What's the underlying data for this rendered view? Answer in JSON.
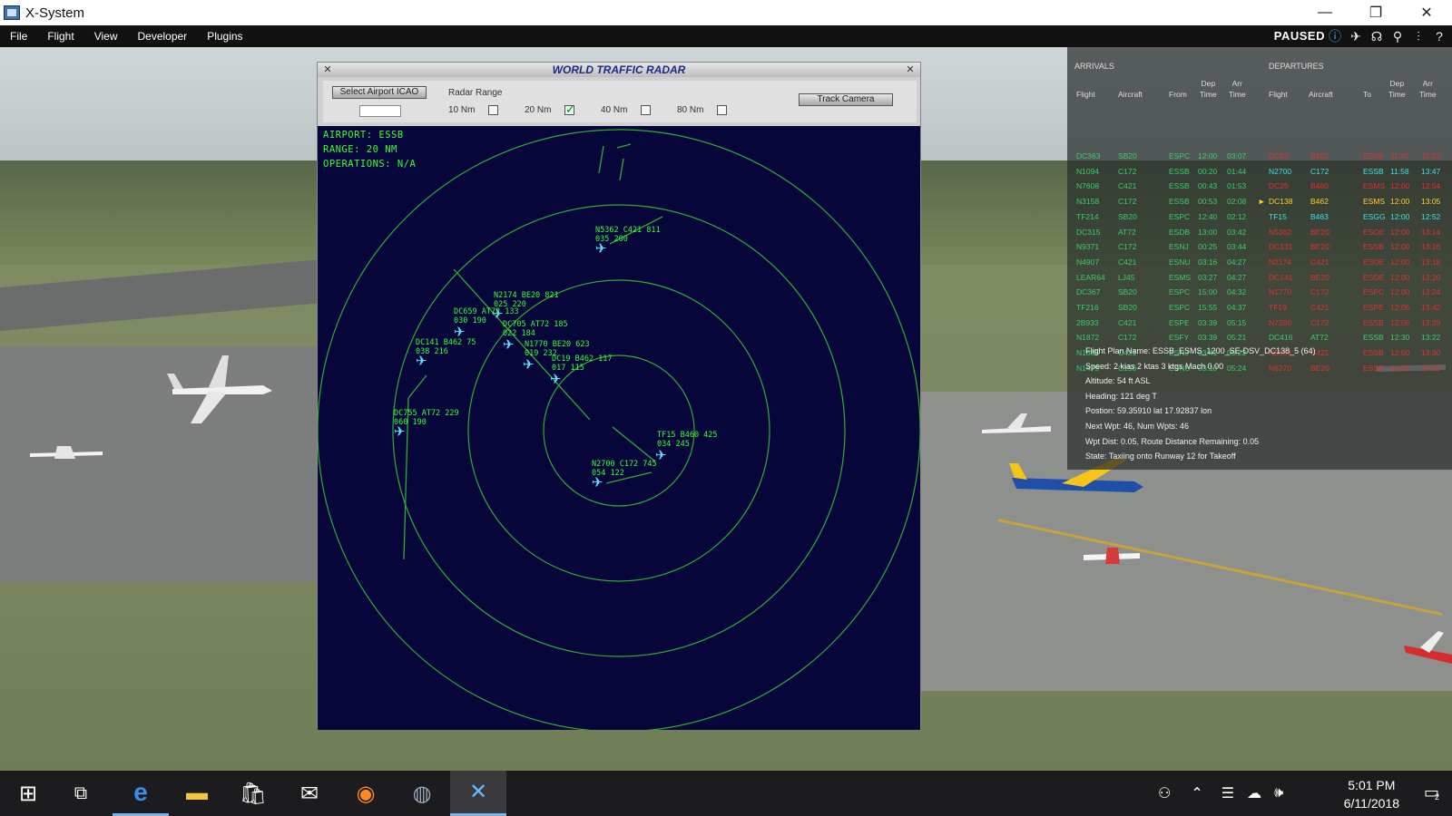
{
  "window": {
    "title": "X-System",
    "minimize": "—",
    "restore": "❐",
    "close": "✕"
  },
  "menubar": {
    "items": [
      "File",
      "Flight",
      "View",
      "Developer",
      "Plugins"
    ],
    "status": "PAUSED"
  },
  "radar": {
    "title": "WORLD TRAFFIC RADAR",
    "select_airport_label": "Select Airport ICAO",
    "icao_value": "",
    "radar_range_label": "Radar Range",
    "ranges": [
      {
        "label": "10 Nm",
        "checked": false
      },
      {
        "label": "20 Nm",
        "checked": true
      },
      {
        "label": "40 Nm",
        "checked": false
      },
      {
        "label": "80 Nm",
        "checked": false
      }
    ],
    "track_camera_label": "Track Camera",
    "airport_line": "AIRPORT:  ESSB",
    "range_line": "RANGE:  20 NM",
    "operations_line": "OPERATIONS:  N/A",
    "targets": [
      {
        "l1": "N5362 C421 811",
        "l2": "035  200"
      },
      {
        "l1": "N2174 BE20 821",
        "l2": "025  220"
      },
      {
        "l1": "DC659 AT72 133",
        "l2": "030  190"
      },
      {
        "l1": "DC705 AT72 185",
        "l2": "022  184"
      },
      {
        "l1": "DC141 B462 75",
        "l2": "038  216"
      },
      {
        "l1": "N1770 BE20 623",
        "l2": "019  232"
      },
      {
        "l1": "DC19 B462 117",
        "l2": "017  115"
      },
      {
        "l1": "DC755 AT72 229",
        "l2": "060  190"
      },
      {
        "l1": "TF15 B460 425",
        "l2": "034  245"
      },
      {
        "l1": "N2700 C172 745",
        "l2": "054  122"
      }
    ]
  },
  "board": {
    "arrivals_label": "ARRIVALS",
    "departures_label": "DEPARTURES",
    "headers": {
      "a_flight": "Flight",
      "a_aircraft": "Aircraft",
      "a_from": "From",
      "a_dep": "Dep\nTime",
      "a_arr": "Arr\nTime",
      "d_flight": "Flight",
      "d_aircraft": "Aircraft",
      "d_to": "To",
      "d_dep": "Dep\nTime",
      "d_arr": "Arr\nTime"
    },
    "arrivals": [
      {
        "flight": "DC363",
        "aircraft": "SB20",
        "from": "ESPC",
        "dep": "12:00",
        "arr": "03:07"
      },
      {
        "flight": "N1094",
        "aircraft": "C172",
        "from": "ESSB",
        "dep": "00:20",
        "arr": "01:44"
      },
      {
        "flight": "N7608",
        "aircraft": "C421",
        "from": "ESSB",
        "dep": "00:43",
        "arr": "01:53"
      },
      {
        "flight": "N3158",
        "aircraft": "C172",
        "from": "ESSB",
        "dep": "00:53",
        "arr": "02:08"
      },
      {
        "flight": "TF214",
        "aircraft": "SB20",
        "from": "ESPC",
        "dep": "12:40",
        "arr": "02:12"
      },
      {
        "flight": "DC315",
        "aircraft": "AT72",
        "from": "ESDB",
        "dep": "13:00",
        "arr": "03:42"
      },
      {
        "flight": "N9371",
        "aircraft": "C172",
        "from": "ESNJ",
        "dep": "00:25",
        "arr": "03:44"
      },
      {
        "flight": "N4907",
        "aircraft": "C421",
        "from": "ESNU",
        "dep": "03:16",
        "arr": "04:27"
      },
      {
        "flight": "LEAR64",
        "aircraft": "LJ45",
        "from": "ESMS",
        "dep": "03:27",
        "arr": "04:27"
      },
      {
        "flight": "DC367",
        "aircraft": "SB20",
        "from": "ESPC",
        "dep": "15:00",
        "arr": "04:32"
      },
      {
        "flight": "TF216",
        "aircraft": "SB20",
        "from": "ESPC",
        "dep": "15:55",
        "arr": "04:37"
      },
      {
        "flight": "2B933",
        "aircraft": "C421",
        "from": "ESPE",
        "dep": "03:39",
        "arr": "05:15"
      },
      {
        "flight": "N1872",
        "aircraft": "C172",
        "from": "ESFY",
        "dep": "03:39",
        "arr": "05:21"
      },
      {
        "flight": "N1885",
        "aircraft": "C421",
        "from": "ESNJ",
        "dep": "03:41",
        "arr": "05:22"
      },
      {
        "flight": "N1479",
        "aircraft": "C150",
        "from": "ESNU",
        "dep": "03:10",
        "arr": "05:24"
      }
    ],
    "departures": [
      {
        "flight": "DC63",
        "aircraft": "B462",
        "to": "ESSB",
        "dep": "11:47",
        "arr": "12:53",
        "status": "red"
      },
      {
        "flight": "N2700",
        "aircraft": "C172",
        "to": "ESSB",
        "dep": "11:58",
        "arr": "13:47",
        "status": "cyan"
      },
      {
        "flight": "DC25",
        "aircraft": "B460",
        "to": "ESMS",
        "dep": "12:00",
        "arr": "12:54",
        "status": "red"
      },
      {
        "flight": "DC138",
        "aircraft": "B462",
        "to": "ESMS",
        "dep": "12:00",
        "arr": "13:05",
        "status": "yellow",
        "marker": "►"
      },
      {
        "flight": "TF15",
        "aircraft": "B463",
        "to": "ESGG",
        "dep": "12:00",
        "arr": "12:52",
        "status": "cyan"
      },
      {
        "flight": "N5362",
        "aircraft": "BE20",
        "to": "ESOE",
        "dep": "12:00",
        "arr": "13:14",
        "status": "red"
      },
      {
        "flight": "DC131",
        "aircraft": "BE20",
        "to": "ESSB",
        "dep": "12:00",
        "arr": "13:16",
        "status": "red"
      },
      {
        "flight": "N2174",
        "aircraft": "C421",
        "to": "ESOE",
        "dep": "12:00",
        "arr": "13:18",
        "status": "red"
      },
      {
        "flight": "DC141",
        "aircraft": "BE20",
        "to": "ESOE",
        "dep": "12:00",
        "arr": "13:20",
        "status": "red"
      },
      {
        "flight": "N1770",
        "aircraft": "C172",
        "to": "ESPC",
        "dep": "12:00",
        "arr": "13:24",
        "status": "red"
      },
      {
        "flight": "TF19",
        "aircraft": "C421",
        "to": "ESPE",
        "dep": "12:06",
        "arr": "13:42",
        "status": "red"
      },
      {
        "flight": "N7260",
        "aircraft": "C172",
        "to": "ESSB",
        "dep": "12:06",
        "arr": "13:39",
        "status": "red"
      },
      {
        "flight": "DC416",
        "aircraft": "AT72",
        "to": "ESSB",
        "dep": "12:30",
        "arr": "13:22",
        "status": "green"
      },
      {
        "flight": "N2614",
        "aircraft": "C421",
        "to": "ESSB",
        "dep": "12:00",
        "arr": "13:30",
        "status": "red"
      },
      {
        "flight": "N6270",
        "aircraft": "BE20",
        "to": "ESSB",
        "dep": "12:05",
        "arr": "13:29",
        "status": "red"
      }
    ],
    "plan_lines": [
      "Flight Plan Name:  ESSB_ESMS_1200_SE-DSV_DC138_5  (64)",
      "Speed:  2 kias  2 ktas  3 ktgs  Mach 0.00",
      "Altitude:  54 ft ASL",
      "Heading:  121 deg T",
      "Postion:  59.35910 lat 17.92837 lon",
      "Next Wpt: 46, Num Wpts: 46",
      "Wpt Dist: 0.05, Route Distance Remaining: 0.05",
      "State:  Taxiing onto Runway 12 for Takeoff"
    ]
  },
  "taskbar": {
    "time": "5:01 PM",
    "date": "6/11/2018",
    "notification_count": "2"
  }
}
